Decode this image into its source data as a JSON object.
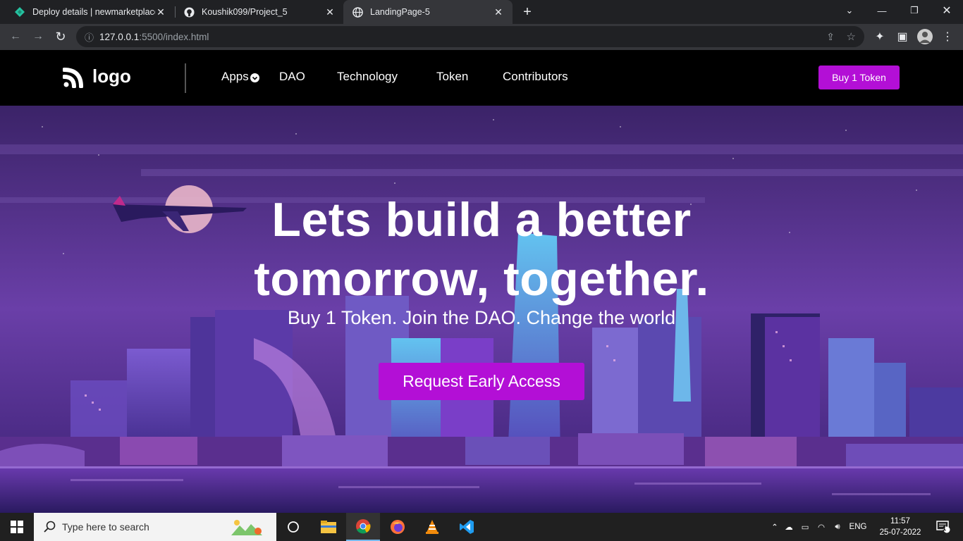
{
  "browser": {
    "tabs": [
      {
        "label": "Deploy details | newmarketplace",
        "icon": "netlify-icon",
        "active": false
      },
      {
        "label": "Koushik099/Project_5",
        "icon": "github-icon",
        "active": false
      },
      {
        "label": "LandingPage-5",
        "icon": "globe-icon",
        "active": true
      }
    ],
    "url_host": "127.0.0.1",
    "url_rest": ":5500/index.html"
  },
  "navbar": {
    "logo_text": "logo",
    "items": [
      "Apps",
      "DAO",
      "Technology",
      "Token",
      "Contributors"
    ],
    "buy_button": "Buy 1 Token"
  },
  "hero": {
    "headline_line1": "Lets build a better",
    "headline_line2": "tomorrow, together.",
    "subline": "Buy 1 Token. Join the DAO. Change the world",
    "cta": "Request Early Access"
  },
  "taskbar": {
    "search_placeholder": "Type here to search",
    "language": "ENG",
    "time": "11:57",
    "date": "25-07-2022",
    "notification_count": "1"
  },
  "colors": {
    "accent": "#b30fd6",
    "navbar": "#000000",
    "chrome_dark": "#202124"
  }
}
